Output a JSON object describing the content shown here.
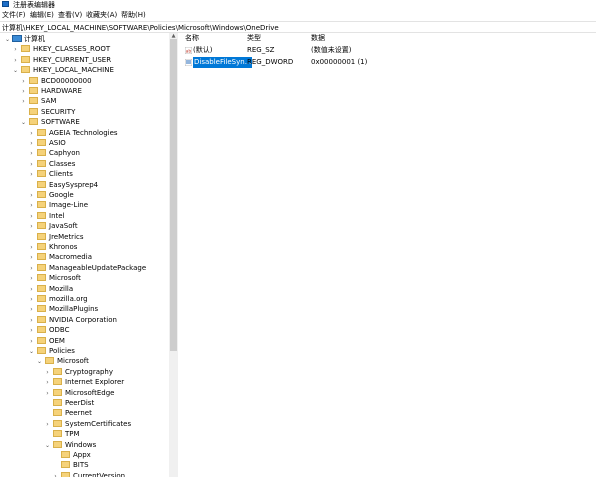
{
  "window": {
    "title": "注册表编辑器"
  },
  "menu": [
    "文件(F)",
    "编辑(E)",
    "查看(V)",
    "收藏夹(A)",
    "帮助(H)"
  ],
  "address": "计算机\\HKEY_LOCAL_MACHINE\\SOFTWARE\\Policies\\Microsoft\\Windows\\OneDrive",
  "tree": [
    {
      "label": "计算机",
      "level": 0,
      "expanded": true,
      "type": "pc"
    },
    {
      "label": "HKEY_CLASSES_ROOT",
      "level": 1,
      "expanded": false
    },
    {
      "label": "HKEY_CURRENT_USER",
      "level": 1,
      "expanded": false
    },
    {
      "label": "HKEY_LOCAL_MACHINE",
      "level": 1,
      "expanded": true
    },
    {
      "label": "BCD00000000",
      "level": 2,
      "expanded": false
    },
    {
      "label": "HARDWARE",
      "level": 2,
      "expanded": false
    },
    {
      "label": "SAM",
      "level": 2,
      "expanded": false
    },
    {
      "label": "SECURITY",
      "level": 2,
      "expanded": false,
      "leaf": true
    },
    {
      "label": "SOFTWARE",
      "level": 2,
      "expanded": true
    },
    {
      "label": "AGEIA Technologies",
      "level": 3,
      "expanded": false
    },
    {
      "label": "ASIO",
      "level": 3,
      "expanded": false
    },
    {
      "label": "Caphyon",
      "level": 3,
      "expanded": false
    },
    {
      "label": "Classes",
      "level": 3,
      "expanded": false
    },
    {
      "label": "Clients",
      "level": 3,
      "expanded": false
    },
    {
      "label": "EasySysprep4",
      "level": 3,
      "expanded": false,
      "leaf": true
    },
    {
      "label": "Google",
      "level": 3,
      "expanded": false
    },
    {
      "label": "Image-Line",
      "level": 3,
      "expanded": false
    },
    {
      "label": "Intel",
      "level": 3,
      "expanded": false
    },
    {
      "label": "JavaSoft",
      "level": 3,
      "expanded": false
    },
    {
      "label": "JreMetrics",
      "level": 3,
      "expanded": false,
      "leaf": true
    },
    {
      "label": "Khronos",
      "level": 3,
      "expanded": false
    },
    {
      "label": "Macromedia",
      "level": 3,
      "expanded": false
    },
    {
      "label": "ManageableUpdatePackage",
      "level": 3,
      "expanded": false
    },
    {
      "label": "Microsoft",
      "level": 3,
      "expanded": false
    },
    {
      "label": "Mozilla",
      "level": 3,
      "expanded": false
    },
    {
      "label": "mozilla.org",
      "level": 3,
      "expanded": false
    },
    {
      "label": "MozillaPlugins",
      "level": 3,
      "expanded": false
    },
    {
      "label": "NVIDIA Corporation",
      "level": 3,
      "expanded": false
    },
    {
      "label": "ODBC",
      "level": 3,
      "expanded": false
    },
    {
      "label": "OEM",
      "level": 3,
      "expanded": false
    },
    {
      "label": "Policies",
      "level": 3,
      "expanded": true
    },
    {
      "label": "Microsoft",
      "level": 4,
      "expanded": true
    },
    {
      "label": "Cryptography",
      "level": 5,
      "expanded": false
    },
    {
      "label": "Internet Explorer",
      "level": 5,
      "expanded": false
    },
    {
      "label": "MicrosoftEdge",
      "level": 5,
      "expanded": false
    },
    {
      "label": "PeerDist",
      "level": 5,
      "expanded": false,
      "leaf": true
    },
    {
      "label": "Peernet",
      "level": 5,
      "expanded": false,
      "leaf": true
    },
    {
      "label": "SystemCertificates",
      "level": 5,
      "expanded": false
    },
    {
      "label": "TPM",
      "level": 5,
      "expanded": false,
      "leaf": true
    },
    {
      "label": "Windows",
      "level": 5,
      "expanded": true
    },
    {
      "label": "Appx",
      "level": 6,
      "expanded": false,
      "leaf": true
    },
    {
      "label": "BITS",
      "level": 6,
      "expanded": false,
      "leaf": true
    },
    {
      "label": "CurrentVersion",
      "level": 6,
      "expanded": false
    }
  ],
  "list": {
    "headers": {
      "name": "名称",
      "type": "类型",
      "data": "数据"
    },
    "rows": [
      {
        "name": "(默认)",
        "type": "REG_SZ",
        "data": "(数值未设置)",
        "icon": "string-value-icon",
        "selected": false
      },
      {
        "name": "DisableFileSyn...",
        "type": "REG_DWORD",
        "data": "0x00000001 (1)",
        "icon": "dword-value-icon",
        "selected": true
      }
    ]
  },
  "colors": {
    "selection": "#0078d7",
    "folder": "#f5d27a"
  }
}
